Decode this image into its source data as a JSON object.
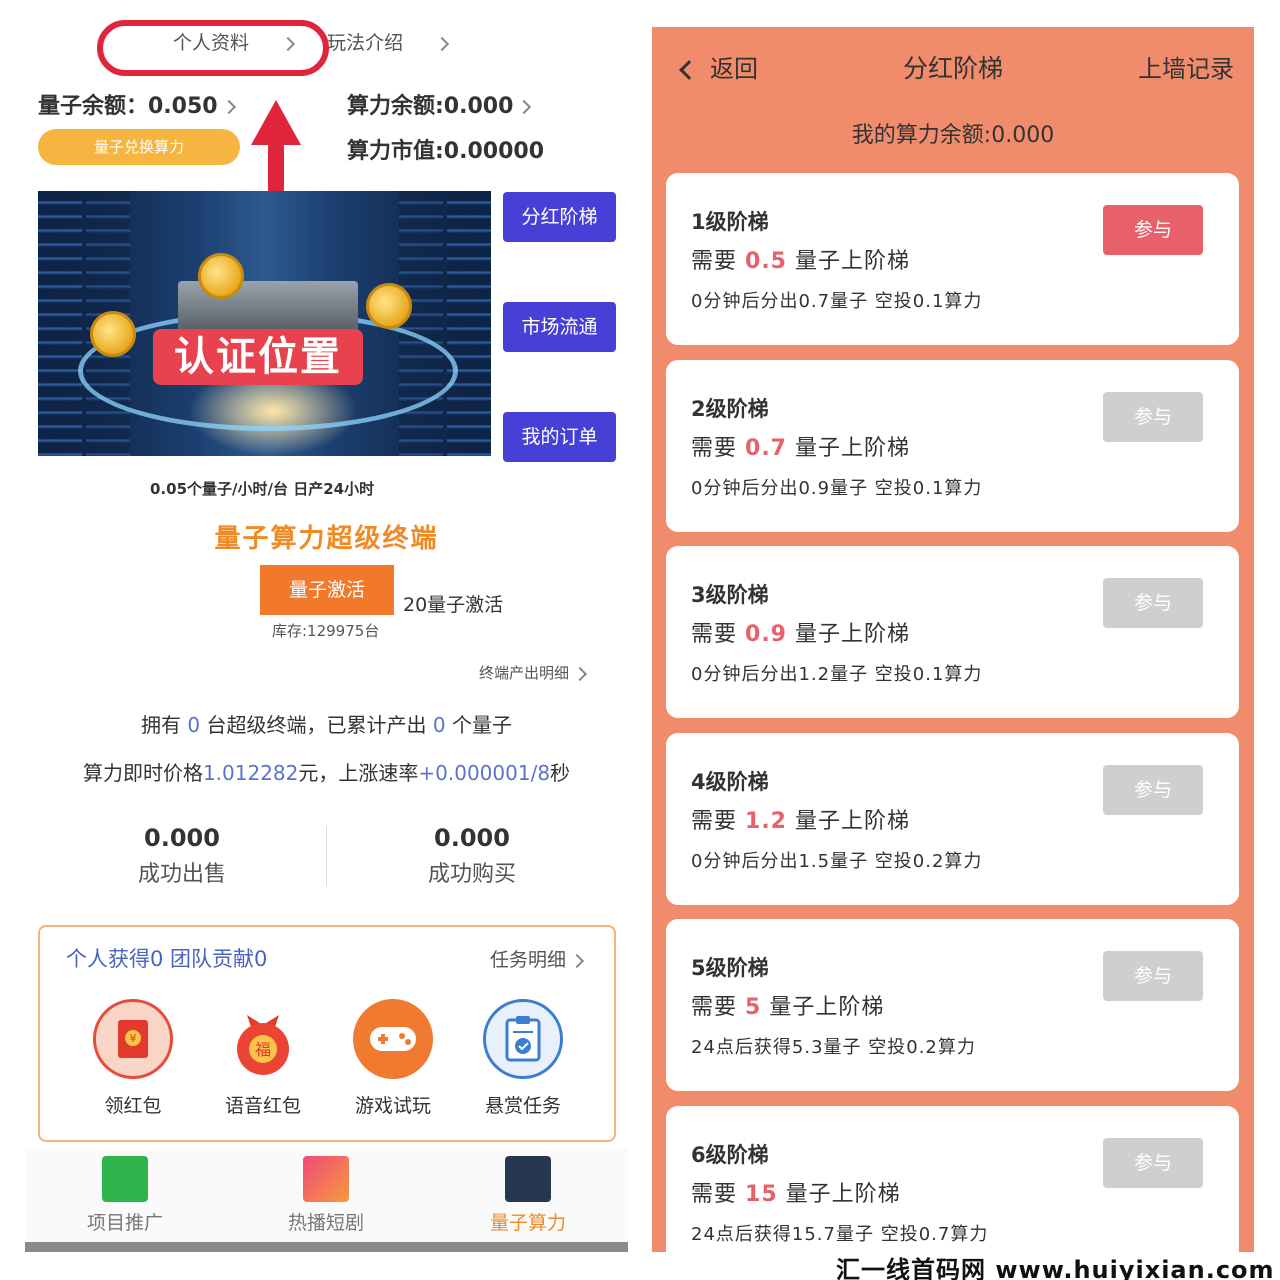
{
  "left": {
    "top_links": {
      "profile": "个人资料",
      "rules": "玩法介绍"
    },
    "balances": {
      "quantum": "量子余额：0.050",
      "power": "算力余额:0.000",
      "market_value": "算力市值:0.00000",
      "exchange_button": "量子兑换算力"
    },
    "hero": {
      "annotation": "认证位置"
    },
    "side_buttons": [
      "分红阶梯",
      "市场流通",
      "我的订单"
    ],
    "rate_text": "0.05个量子/小时/台 日产24小时",
    "terminal_title": "量子算力超级终端",
    "activate_button": "量子激活",
    "activate_note": "20量子激活",
    "stock": "库存:129975台",
    "terminal_detail": "终端产出明细",
    "own_line": {
      "p1": "拥有 ",
      "count": "0",
      "p2": " 台超级终端，已累计产出 ",
      "output": "0",
      "p3": " 个量子"
    },
    "price_line": {
      "p1": "算力即时价格",
      "price": "1.012282",
      "p2": "元，上涨速率",
      "rate": "+0.000001/8",
      "p3": "秒"
    },
    "stats": [
      {
        "value": "0.000",
        "label": "成功出售"
      },
      {
        "value": "0.000",
        "label": "成功购买"
      }
    ],
    "tasks": {
      "header": "个人获得0 团队贡献0",
      "detail": "任务明细",
      "items": [
        {
          "label": "领红包",
          "icon": "red-envelope-icon"
        },
        {
          "label": "语音红包",
          "icon": "fortune-bag-icon"
        },
        {
          "label": "游戏试玩",
          "icon": "gamepad-icon"
        },
        {
          "label": "悬赏任务",
          "icon": "clipboard-icon"
        }
      ]
    },
    "nav": [
      {
        "label": "项目推广",
        "icon": "ad-icon"
      },
      {
        "label": "热播短剧",
        "icon": "video-icon"
      },
      {
        "label": "量子算力",
        "icon": "chip-icon"
      }
    ],
    "colors": {
      "accent": "#f08a24",
      "primary_button": "#4640d6",
      "highlight": "#e0243a"
    }
  },
  "right": {
    "back": "返回",
    "title": "分红阶梯",
    "record": "上墙记录",
    "balance": "我的算力余额:0.000",
    "need_prefix": "需要",
    "need_suffix": "量子上阶梯",
    "join_label": "参与",
    "levels": [
      {
        "name": "1级阶梯",
        "amount": "0.5",
        "output": "0分钟后分出0.7量子 空投0.1算力",
        "active": true
      },
      {
        "name": "2级阶梯",
        "amount": "0.7",
        "output": "0分钟后分出0.9量子 空投0.1算力",
        "active": false
      },
      {
        "name": "3级阶梯",
        "amount": "0.9",
        "output": "0分钟后分出1.2量子 空投0.1算力",
        "active": false
      },
      {
        "name": "4级阶梯",
        "amount": "1.2",
        "output": "0分钟后分出1.5量子 空投0.2算力",
        "active": false
      },
      {
        "name": "5级阶梯",
        "amount": "5",
        "output": "24点后获得5.3量子 空投0.2算力",
        "active": false
      },
      {
        "name": "6级阶梯",
        "amount": "15",
        "output": "24点后获得15.7量子 空投0.7算力",
        "active": false
      }
    ],
    "colors": {
      "background": "#f08c6b",
      "active_button": "#e8606a",
      "disabled_button": "#cfcfcf"
    }
  },
  "watermark": "汇一线首码网 www.huiyixian.com"
}
